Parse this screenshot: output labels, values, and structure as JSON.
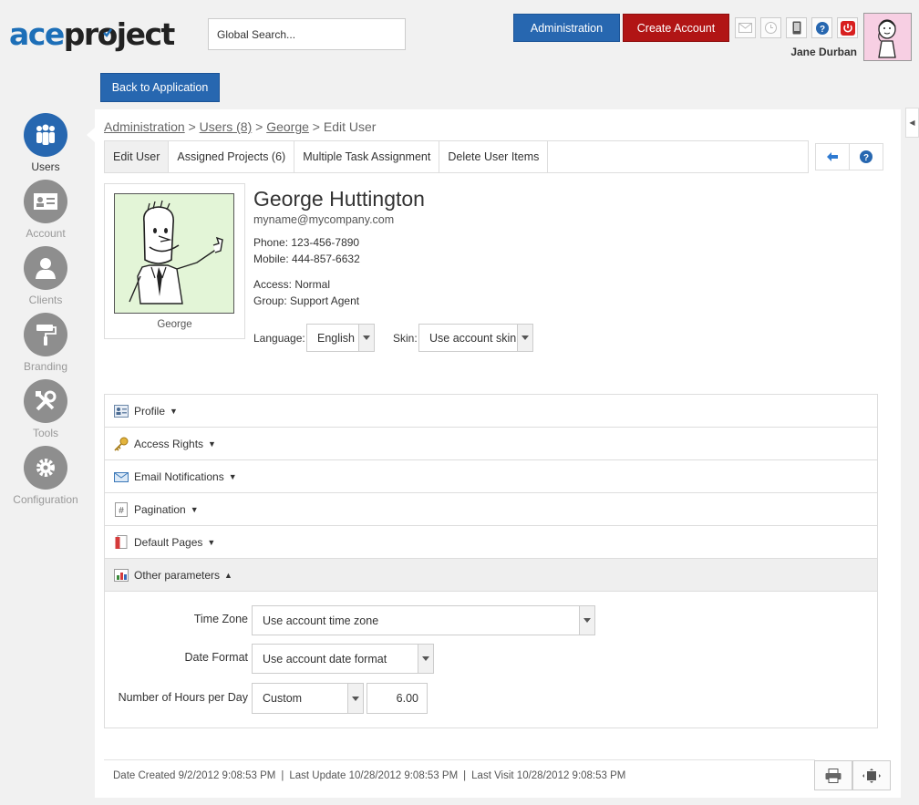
{
  "app": {
    "logo_part1": "ace",
    "logo_part2": "pr",
    "logo_part3": "ject",
    "search_placeholder": "Global Search...",
    "admin_button": "Administration",
    "create_account_button": "Create Account",
    "current_user": "Jane Durban",
    "back_button": "Back to Application"
  },
  "nav": [
    {
      "label": "Users",
      "icon": "users-icon",
      "active": true
    },
    {
      "label": "Account",
      "icon": "account-card-icon",
      "active": false
    },
    {
      "label": "Clients",
      "icon": "client-icon",
      "active": false
    },
    {
      "label": "Branding",
      "icon": "paint-roller-icon",
      "active": false
    },
    {
      "label": "Tools",
      "icon": "tools-icon",
      "active": false
    },
    {
      "label": "Configuration",
      "icon": "gear-icon",
      "active": false
    }
  ],
  "breadcrumb": {
    "item1": "Administration",
    "item2": "Users (8)",
    "item3": "George",
    "current": "Edit User",
    "separator": ">"
  },
  "tabs": [
    "Edit User",
    "Assigned Projects (6)",
    "Multiple Task Assignment",
    "Delete User Items"
  ],
  "user": {
    "photo_caption": "George",
    "full_name": "George Huttington",
    "email": "myname@mycompany.com",
    "phone": "Phone: 123-456-7890",
    "mobile": "Mobile: 444-857-6632",
    "access": "Access: Normal",
    "group": "Group: Support Agent",
    "language_label": "Language:",
    "language_value": "English",
    "skin_label": "Skin:",
    "skin_value": "Use account skin"
  },
  "sections": [
    {
      "label": "Profile",
      "arrow": "▼"
    },
    {
      "label": "Access Rights",
      "arrow": "▼"
    },
    {
      "label": "Email Notifications",
      "arrow": "▼"
    },
    {
      "label": "Pagination",
      "arrow": "▼"
    },
    {
      "label": "Default Pages",
      "arrow": "▼"
    },
    {
      "label": "Other parameters",
      "arrow": "▲"
    }
  ],
  "other_params": {
    "time_zone_label": "Time Zone",
    "time_zone_value": "Use account time zone",
    "date_format_label": "Date Format",
    "date_format_value": "Use account date format",
    "hours_label": "Number of Hours per Day",
    "hours_mode": "Custom",
    "hours_value": "6.00"
  },
  "footer": {
    "date_created": "Date Created 9/2/2012 9:08:53 PM",
    "last_update": "Last Update 10/28/2012 9:08:53 PM",
    "last_visit": "Last Visit 10/28/2012 9:08:53 PM",
    "separator": "|"
  },
  "colors": {
    "primary_blue": "#2767b0",
    "create_red": "#b11515",
    "logo_blue": "#1d6fb8"
  }
}
